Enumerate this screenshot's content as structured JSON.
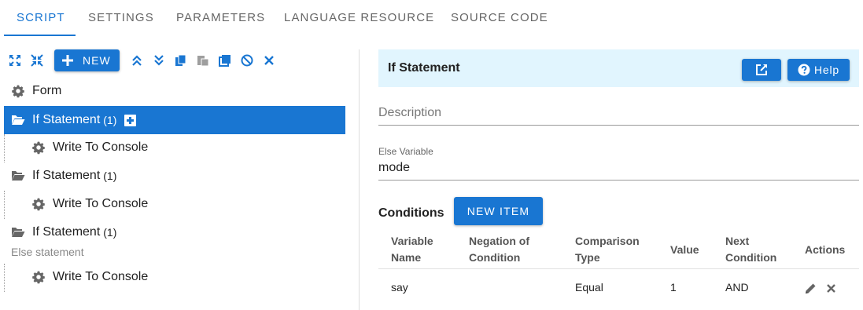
{
  "tabs": [
    {
      "label": "SCRIPT"
    },
    {
      "label": "SETTINGS"
    },
    {
      "label": "PARAMETERS"
    },
    {
      "label": "LANGUAGE RESOURCE"
    },
    {
      "label": "SOURCE CODE"
    }
  ],
  "toolbar": {
    "new_label": "NEW",
    "icons": [
      "expand-all-icon",
      "collapse-all-icon",
      "add-icon",
      "move-up-icon",
      "move-down-icon",
      "copy-icon",
      "paste-icon",
      "duplicate-icon",
      "disable-icon",
      "delete-icon"
    ]
  },
  "tree": {
    "items": [
      {
        "label": "Form",
        "count": ""
      },
      {
        "label": "If Statement",
        "count": "(1)"
      },
      {
        "label": "Write To Console",
        "count": ""
      },
      {
        "label": "If Statement",
        "count": "(1)"
      },
      {
        "label": "Write To Console",
        "count": ""
      },
      {
        "label": "If Statement",
        "count": "(1)"
      },
      {
        "label": "Write To Console",
        "count": ""
      }
    ],
    "else_label": "Else statement"
  },
  "panel": {
    "title": "If Statement",
    "help_label": "Help",
    "description_placeholder": "Description",
    "else_variable_label": "Else Variable",
    "else_variable_value": "mode",
    "conditions_title": "Conditions",
    "new_item_label": "NEW ITEM"
  },
  "table": {
    "headers": {
      "variable_name": "Variable Name",
      "negation": "Negation of Condition",
      "comparison": "Comparison Type",
      "value": "Value",
      "next": "Next Condition",
      "actions": "Actions"
    },
    "rows": [
      {
        "variable_name": "say",
        "negation": "",
        "comparison": "Equal",
        "value": "1",
        "next": "AND"
      }
    ]
  },
  "colors": {
    "accent": "#1976d2",
    "header_bg": "#e1f5fe"
  }
}
